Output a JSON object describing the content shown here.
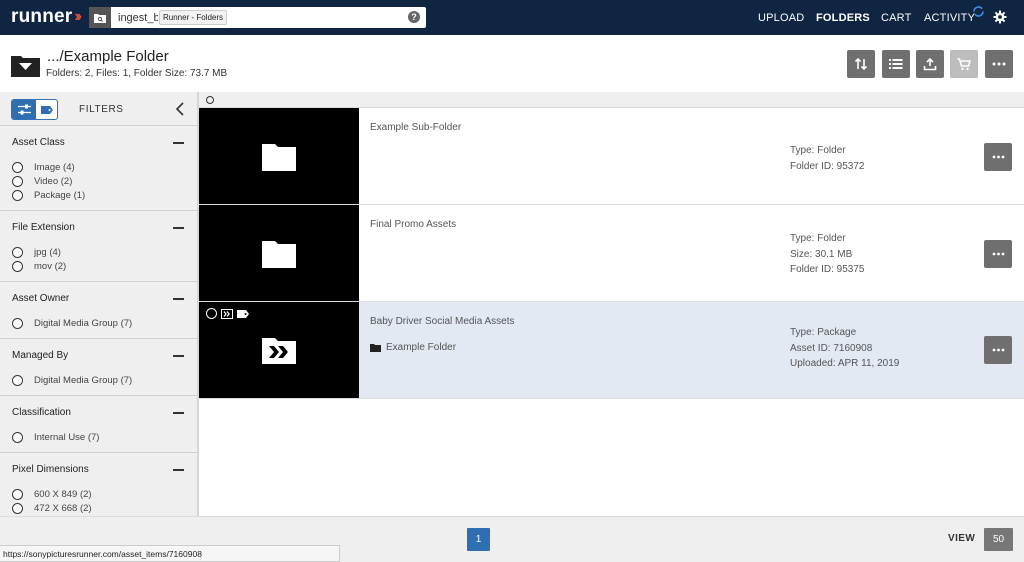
{
  "app": {
    "logo_text": "runner",
    "accent": "#e8533a",
    "nav_bg": "#0f2541"
  },
  "search": {
    "value": "ingest_ba",
    "tooltip": "Runner - Folders",
    "help": "?"
  },
  "nav": {
    "upload": "UPLOAD",
    "folders": "FOLDERS",
    "cart": "CART",
    "activity": "ACTIVITY"
  },
  "header": {
    "title": ".../Example Folder",
    "meta": "Folders: 2, Files: 1, Folder Size: 73.7 MB",
    "buttons": [
      "sort-icon",
      "list-view-icon",
      "upload-icon",
      "cart-icon",
      "more-icon"
    ]
  },
  "sidebar": {
    "filters_label": "FILTERS",
    "groups": [
      {
        "title": "Asset Class",
        "options": [
          "Image (4)",
          "Video (2)",
          "Package (1)"
        ]
      },
      {
        "title": "File Extension",
        "options": [
          "jpg (4)",
          "mov (2)"
        ]
      },
      {
        "title": "Asset Owner",
        "options": [
          "Digital Media Group (7)"
        ]
      },
      {
        "title": "Managed By",
        "options": [
          "Digital Media Group (7)"
        ]
      },
      {
        "title": "Classification",
        "options": [
          "Internal Use (7)"
        ]
      },
      {
        "title": "Pixel Dimensions",
        "options": [
          "600 X 849 (2)",
          "472 X 668 (2)"
        ]
      }
    ]
  },
  "items": [
    {
      "title": "Example Sub-Folder",
      "meta": [
        "Type: Folder",
        "Folder ID: 95372"
      ]
    },
    {
      "title": "Final Promo Assets",
      "meta": [
        "Type: Folder",
        "Size: 30.1 MB",
        "Folder ID: 95375"
      ]
    },
    {
      "title": "Baby Driver Social Media Assets",
      "sub": "Example Folder",
      "meta": [
        "Type: Package",
        "Asset ID: 7160908",
        "Uploaded: APR 11, 2019"
      ]
    }
  ],
  "footer": {
    "page": "1",
    "view_label": "VIEW",
    "view_count": "50"
  },
  "status_url": "https://sonypicturesrunner.com/asset_items/7160908"
}
